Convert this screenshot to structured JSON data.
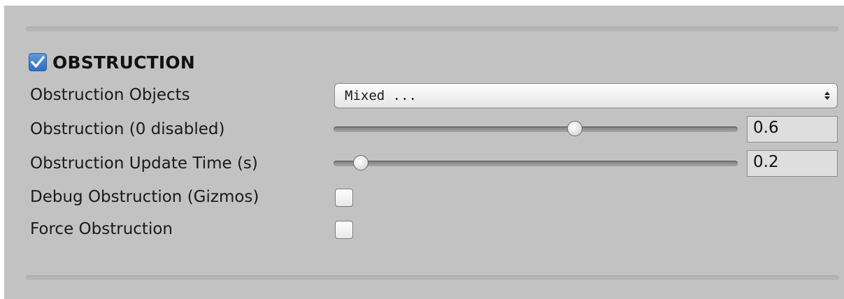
{
  "section": {
    "title": "OBSTRUCTION",
    "enabled": true,
    "icons": {
      "enable": "checkmark-icon"
    }
  },
  "fields": {
    "objects": {
      "label": "Obstruction Objects",
      "value": "Mixed ..."
    },
    "amount": {
      "label": "Obstruction (0 disabled)",
      "value": "0.6",
      "min": 0,
      "max": 1,
      "level": 0.6
    },
    "update_time": {
      "label": "Obstruction Update Time (s)",
      "value": "0.2",
      "level": 0.05
    },
    "debug": {
      "label": "Debug Obstruction (Gizmos)",
      "checked": false
    },
    "force": {
      "label": "Force Obstruction",
      "checked": false
    }
  },
  "colors": {
    "panel": "#c2c2c2",
    "accent": "#3a7ccc"
  }
}
